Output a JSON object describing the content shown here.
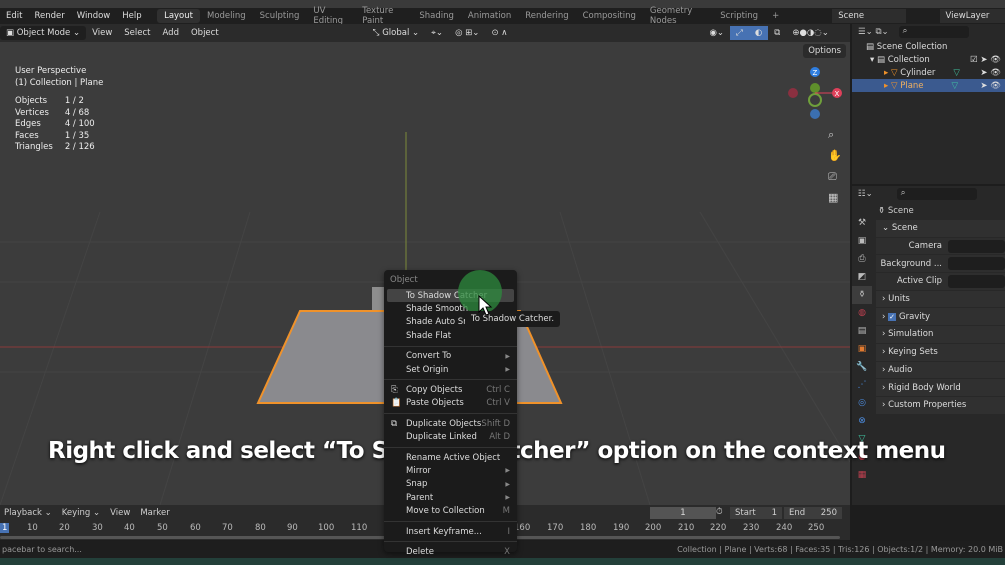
{
  "menubar": {
    "menus": [
      "Edit",
      "Render",
      "Window",
      "Help"
    ],
    "workspaces": [
      "Layout",
      "Modeling",
      "Sculpting",
      "UV Editing",
      "Texture Paint",
      "Shading",
      "Animation",
      "Rendering",
      "Compositing",
      "Geometry Nodes",
      "Scripting"
    ],
    "active_workspace": "Layout",
    "scene": "Scene",
    "view_layer": "ViewLayer"
  },
  "viewport_header": {
    "mode": "Object Mode",
    "menus": [
      "View",
      "Select",
      "Add",
      "Object"
    ],
    "orientation": "Global",
    "options": "Options"
  },
  "overlay": {
    "view": "User Perspective",
    "context": "(1) Collection | Plane",
    "stats": [
      [
        "Objects",
        "1 / 2"
      ],
      [
        "Vertices",
        "4 / 68"
      ],
      [
        "Edges",
        "4 / 100"
      ],
      [
        "Faces",
        "1 / 35"
      ],
      [
        "Triangles",
        "2 / 126"
      ]
    ]
  },
  "gizmo": {
    "z": "Z",
    "y": "Y",
    "x": "X"
  },
  "context_menu": {
    "title": "Object",
    "items": [
      {
        "label": "To Shadow Catcher",
        "highlighted": true
      },
      {
        "label": "Shade Smooth"
      },
      {
        "label": "Shade Auto Sm"
      },
      {
        "label": "Shade Flat",
        "sep_after": true
      },
      {
        "label": "Convert To",
        "submenu": true
      },
      {
        "label": "Set Origin",
        "submenu": true,
        "sep_after": true
      },
      {
        "label": "Copy Objects",
        "shortcut": "Ctrl C"
      },
      {
        "label": "Paste Objects",
        "shortcut": "Ctrl V",
        "sep_after": true
      },
      {
        "label": "Duplicate Objects",
        "shortcut": "Shift D"
      },
      {
        "label": "Duplicate Linked",
        "shortcut": "Alt D",
        "sep_after": true
      },
      {
        "label": "Rename Active Object"
      },
      {
        "label": "Mirror",
        "submenu": true
      },
      {
        "label": "Snap",
        "submenu": true
      },
      {
        "label": "Parent",
        "submenu": true
      },
      {
        "label": "Move to Collection",
        "shortcut": "M",
        "sep_after": true
      },
      {
        "label": "Insert Keyframe...",
        "shortcut": "I",
        "sep_after": true
      },
      {
        "label": "Delete",
        "shortcut": "X"
      }
    ]
  },
  "tooltip": "To Shadow Catcher.",
  "caption": "Right click and select “To Shadow Catcher” option on the context menu",
  "outliner": {
    "root": "Scene Collection",
    "collection": "Collection",
    "objects": [
      "Cylinder",
      "Plane"
    ],
    "selected": "Plane"
  },
  "properties": {
    "header": "Scene",
    "panel": "Scene",
    "fields": [
      "Camera",
      "Background ...",
      "Active Clip"
    ],
    "sections": [
      "Units",
      "Gravity",
      "Simulation",
      "Keying Sets",
      "Audio",
      "Rigid Body World",
      "Custom Properties"
    ]
  },
  "timeline": {
    "menus": [
      "Playback",
      "Keying",
      "View",
      "Marker"
    ],
    "current_frame": "1",
    "start_label": "Start",
    "start": "1",
    "end_label": "End",
    "end": "250",
    "ticks": [
      "1",
      "10",
      "20",
      "30",
      "40",
      "50",
      "60",
      "70",
      "80",
      "90",
      "100",
      "110",
      "160",
      "170",
      "180",
      "190",
      "200",
      "210",
      "220",
      "230",
      "240",
      "250"
    ]
  },
  "statusbar": {
    "hint": "pacebar to search...",
    "info": "Collection | Plane | Verts:68 | Faces:35 | Tris:126 | Objects:1/2 | Memory: 20.0 MiB"
  },
  "colors": {
    "selection_orange": "#f0922a",
    "highlight_blue": "#3b5a8f",
    "cursor_green": "#2e8b3e"
  }
}
